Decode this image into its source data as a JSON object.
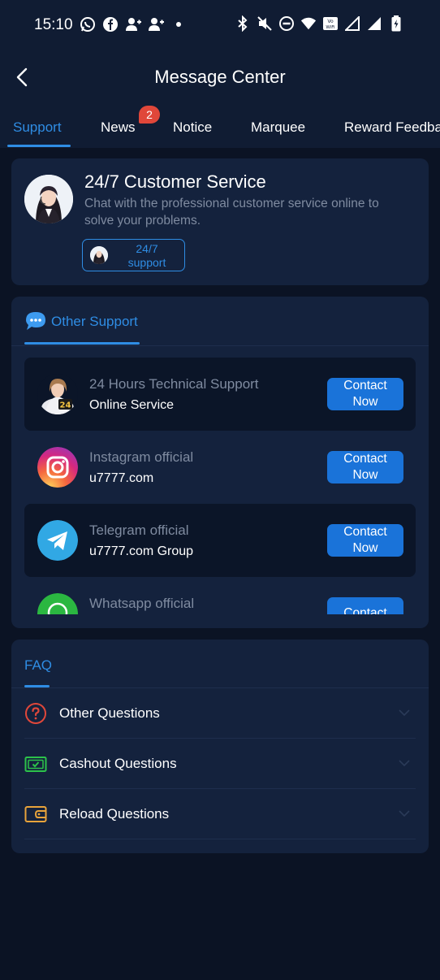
{
  "status_bar": {
    "time": "15:10"
  },
  "header": {
    "title": "Message Center"
  },
  "tabs": [
    {
      "label": "Support",
      "active": true
    },
    {
      "label": "News",
      "badge": "2"
    },
    {
      "label": "Notice"
    },
    {
      "label": "Marquee"
    },
    {
      "label": "Reward Feedba"
    }
  ],
  "customer_service": {
    "title": "24/7 Customer Service",
    "description": "Chat with the professional customer service online to solve your problems.",
    "button_line1": "24/7",
    "button_line2": "support"
  },
  "other_support": {
    "title": "Other Support",
    "items": [
      {
        "title": "24 Hours Technical Support",
        "subtitle": "Online Service",
        "button": "Contact Now",
        "icon": "agent-24-icon"
      },
      {
        "title": "Instagram official",
        "subtitle": "u7777.com",
        "button": "Contact Now",
        "icon": "instagram-icon"
      },
      {
        "title": "Telegram official",
        "subtitle": "u7777.com Group",
        "button": "Contact Now",
        "icon": "telegram-icon"
      },
      {
        "title": "Whatsapp official",
        "subtitle": "",
        "button": "Contact",
        "icon": "whatsapp-icon"
      }
    ]
  },
  "faq": {
    "title": "FAQ",
    "items": [
      {
        "label": "Other Questions",
        "icon": "question-icon",
        "color": "#e0473a"
      },
      {
        "label": "Cashout Questions",
        "icon": "cash-icon",
        "color": "#2cc24a"
      },
      {
        "label": "Reload Questions",
        "icon": "wallet-icon",
        "color": "#e8a33b"
      }
    ]
  },
  "colors": {
    "accent": "#2f8de4",
    "button": "#1a73d9",
    "background": "#0b1324",
    "card": "#14223d"
  }
}
